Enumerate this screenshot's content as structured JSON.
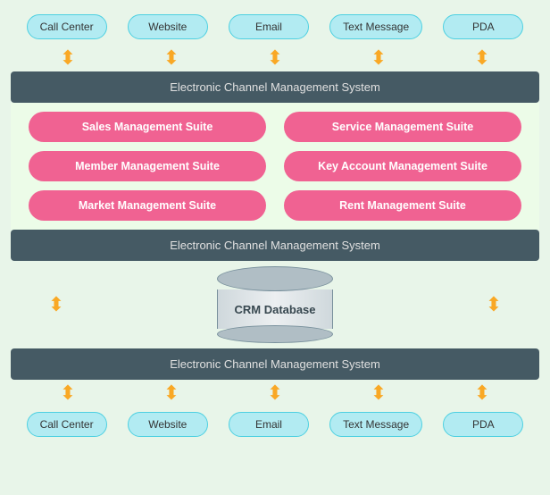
{
  "channels_top": {
    "items": [
      {
        "label": "Call Center"
      },
      {
        "label": "Website"
      },
      {
        "label": "Email"
      },
      {
        "label": "Text Message"
      },
      {
        "label": "PDA"
      }
    ]
  },
  "channels_bottom": {
    "items": [
      {
        "label": "Call Center"
      },
      {
        "label": "Website"
      },
      {
        "label": "Email"
      },
      {
        "label": "Text Message"
      },
      {
        "label": "PDA"
      }
    ]
  },
  "bars": {
    "top": "Electronic Channel Management System",
    "middle": "Electronic Channel Management System",
    "bottom": "Electronic Channel Management System"
  },
  "suites": {
    "left": [
      {
        "label": "Sales Management Suite"
      },
      {
        "label": "Member Management Suite"
      },
      {
        "label": "Market Management Suite"
      }
    ],
    "right": [
      {
        "label": "Service Management Suite"
      },
      {
        "label": "Key Account Management Suite"
      },
      {
        "label": "Rent Management Suite"
      }
    ]
  },
  "crm": {
    "label": "CRM Database"
  },
  "arrow_symbol": "⬍",
  "arrow_down_symbol": "⬇",
  "arrow_up_symbol": "⬆"
}
